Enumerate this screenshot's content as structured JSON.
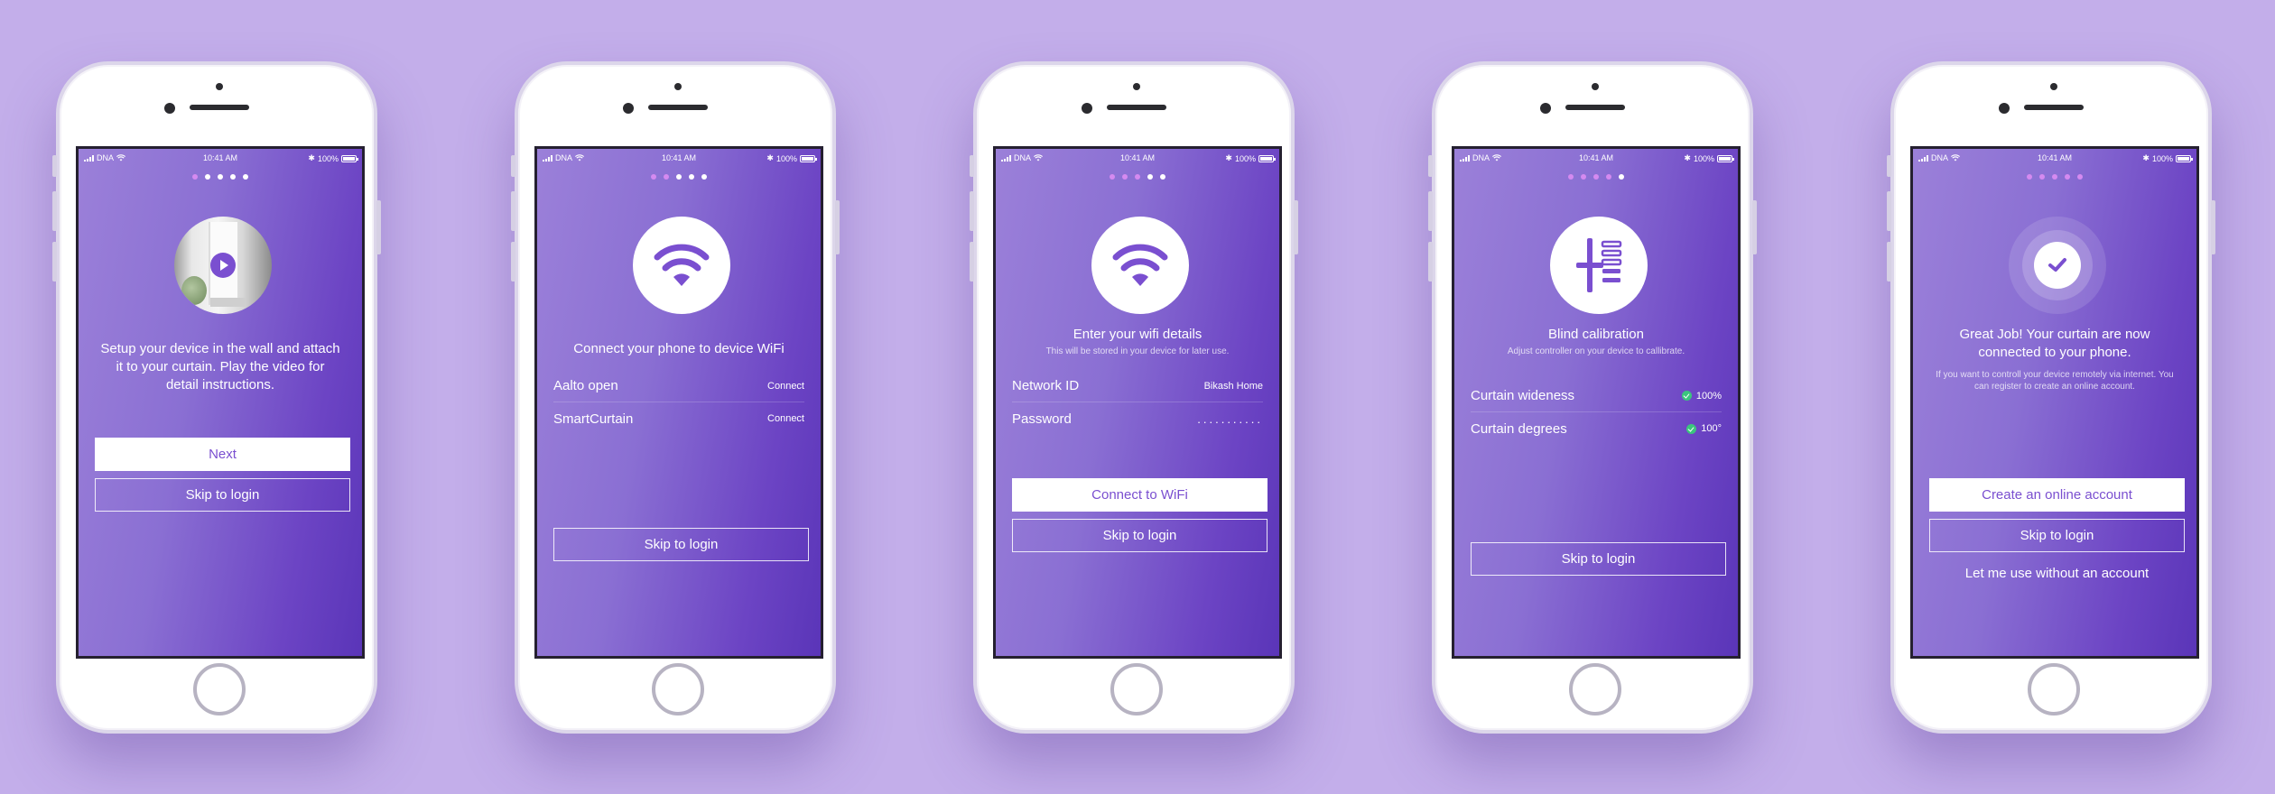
{
  "colors": {
    "background": "#c3aeea",
    "accent": "#7a4fd0",
    "dot_active": "#d58af0",
    "check": "#3bc57d"
  },
  "status": {
    "carrier": "DNA",
    "time": "10:41 AM",
    "battery": "100%"
  },
  "screens": [
    {
      "step": 1,
      "hero_icon": "video-play-icon",
      "title": "Setup your device in the wall and attach it to your curtain. Play the video for detail instructions.",
      "primary_button": "Next",
      "secondary_button": "Skip to login"
    },
    {
      "step": 2,
      "hero_icon": "wifi-icon",
      "title": "Connect your phone to device WiFi",
      "networks": [
        {
          "name": "Aalto open",
          "action": "Connect"
        },
        {
          "name": "SmartCurtain",
          "action": "Connect"
        }
      ],
      "secondary_button": "Skip to login"
    },
    {
      "step": 3,
      "hero_icon": "wifi-icon",
      "title": "Enter your wifi details",
      "subtitle": "This will be stored in your device for later use.",
      "fields": [
        {
          "label": "Network ID",
          "value": "Bikash Home"
        },
        {
          "label": "Password",
          "value": "..........."
        }
      ],
      "primary_button": "Connect to WiFi",
      "secondary_button": "Skip to login"
    },
    {
      "step": 4,
      "hero_icon": "calibration-slider-icon",
      "title": "Blind calibration",
      "subtitle": "Adjust controller on your device to callibrate.",
      "settings": [
        {
          "label": "Curtain wideness",
          "value": "100%"
        },
        {
          "label": "Curtain degrees",
          "value": "100°"
        }
      ],
      "secondary_button": "Skip to login"
    },
    {
      "step": 5,
      "hero_icon": "check-icon",
      "title": "Great Job! Your curtain are now connected to your phone.",
      "subtitle": "If you want to controll your device remotely via internet. You can register to create an online account.",
      "primary_button": "Create an online account",
      "secondary_button": "Skip to login",
      "link": "Let me use without an account"
    }
  ]
}
